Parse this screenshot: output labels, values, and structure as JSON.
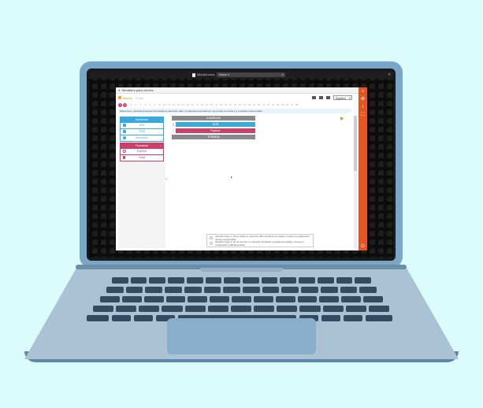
{
  "browser": {
    "brand": "Mblock/Lumos",
    "tab_title": "Nuevo ▾",
    "tab_close": "✕",
    "window_close": "✕"
  },
  "app": {
    "window_title": "4. Semáforo para coches",
    "toolbar": {
      "new_label": "Nuevo",
      "edit_label": "Editar",
      "language": "Español",
      "language_chevron": "▾"
    },
    "steps": [
      "1",
      "2",
      "3",
      "4",
      "5",
      "6",
      "7",
      "8",
      "9",
      "10",
      "11",
      "12",
      "13",
      "14",
      "15",
      "16",
      "17",
      "18",
      "19",
      "20",
      "21",
      "22",
      "23",
      "24",
      "25",
      "26",
      "27",
      "28",
      "29",
      "30",
      "31",
      "32",
      "33",
      "34",
      "35",
      "36",
      "37",
      "38"
    ],
    "instruction": "Selecciona y arrastra al espacio de trabajo un elemento LED. Configúrelo para alternar rojo a color en Verde 2 y a rosado en Encendido.",
    "left_panel": {
      "elements_header": "Elementos",
      "elements": [
        {
          "label": "LED"
        },
        {
          "label": "RGB"
        },
        {
          "label": "Zumbador"
        }
      ],
      "functions_header": "Funciones",
      "functions": [
        {
          "label": "Esperar"
        },
        {
          "label": "Pulsa"
        }
      ],
      "minimize": "–"
    },
    "canvas": {
      "blocks": [
        {
          "label": "COMIENZA"
        },
        {
          "label": "RGB"
        },
        {
          "label": "Esperar"
        },
        {
          "label": "TERMINA"
        }
      ],
      "play": "▶",
      "console": [
        "Atención: Paso 1: No se realizó un elemento LED al espacio de trabajo o revisa su configuración (Verde 2, Encendido).",
        "Atención: Paso 2: No se encontró un elemento Zumbador al espacio de trabajo o revisa su configuración (180,Encendido)."
      ]
    },
    "rail_icons": [
      "home-icon",
      "settings-icon",
      "info-icon",
      "fullscreen-icon",
      "power-icon"
    ]
  },
  "colors": {
    "background": "#dcfbfb",
    "laptop_lid": "#7aa6c9",
    "accent_orange": "#e8541e",
    "blue": "#36a9e1",
    "pink": "#cc3f6a",
    "green_text": "#c2c03a"
  }
}
